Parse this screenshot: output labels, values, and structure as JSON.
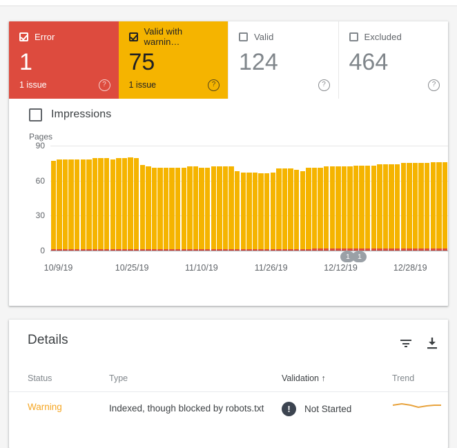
{
  "summary": {
    "cards": [
      {
        "label": "Error",
        "value": "1",
        "sub": "1 issue",
        "help": "?",
        "state": "error",
        "checked": true
      },
      {
        "label": "Valid with warnin…",
        "value": "75",
        "sub": "1 issue",
        "help": "?",
        "state": "warning",
        "checked": true
      },
      {
        "label": "Valid",
        "value": "124",
        "sub": "",
        "help": "?",
        "state": "valid",
        "checked": false
      },
      {
        "label": "Excluded",
        "value": "464",
        "sub": "",
        "help": "?",
        "state": "excluded",
        "checked": false
      }
    ]
  },
  "impressions": {
    "label": "Impressions",
    "checked": false
  },
  "chart_data": {
    "type": "bar",
    "title": "",
    "xlabel": "",
    "ylabel": "Pages",
    "ylim": [
      0,
      90
    ],
    "yticks": [
      "0",
      "30",
      "60",
      "90"
    ],
    "grid": true,
    "legend": "none",
    "categories": [
      "10/9/19",
      "10/25/19",
      "11/10/19",
      "11/26/19",
      "12/12/19",
      "12/28/19"
    ],
    "tick_positions_pct": [
      2,
      20.5,
      38,
      55.5,
      73,
      90.5
    ],
    "series": [
      {
        "name": "Valid with warnings",
        "color": "#f5b400",
        "values": [
          77,
          78,
          78,
          78,
          78,
          78,
          78,
          79,
          79,
          79,
          78,
          79,
          79,
          80,
          79,
          73,
          72,
          71,
          71,
          71,
          71,
          71,
          71,
          72,
          72,
          71,
          71,
          72,
          72,
          72,
          72,
          68,
          67,
          67,
          67,
          66,
          66,
          67,
          70,
          70,
          70,
          69,
          68,
          71,
          71,
          71,
          72,
          72,
          72,
          72,
          72,
          73,
          73,
          73,
          73,
          74,
          74,
          74,
          74,
          75,
          75,
          75,
          75,
          75,
          76,
          76,
          76
        ]
      },
      {
        "name": "Error",
        "color": "#dd4b3e",
        "values": [
          1,
          1,
          1,
          1,
          1,
          1,
          1,
          1,
          1,
          1,
          1,
          1,
          1,
          1,
          1,
          1,
          1,
          1,
          1,
          1,
          1,
          1,
          1,
          1,
          1,
          1,
          1,
          1,
          1,
          1,
          1,
          1,
          1,
          1,
          1,
          1,
          1,
          1,
          1,
          1,
          1,
          1,
          1,
          1,
          2,
          2,
          2,
          2,
          2,
          2,
          2,
          2,
          2,
          2,
          2,
          2,
          2,
          2,
          2,
          2,
          2,
          2,
          2,
          2,
          2,
          2,
          2
        ]
      }
    ],
    "annotations": [
      {
        "label": "1",
        "x_pct": 73
      },
      {
        "label": "1",
        "x_pct": 75.5
      }
    ]
  },
  "details": {
    "title": "Details",
    "filter_icon": "filter-icon",
    "download_icon": "download-icon",
    "columns": [
      {
        "key": "status",
        "label": "Status",
        "sorted": false
      },
      {
        "key": "type",
        "label": "Type",
        "sorted": false
      },
      {
        "key": "validation",
        "label": "Validation",
        "sorted": true,
        "sort_arrow": "↑"
      },
      {
        "key": "trend",
        "label": "Trend",
        "sorted": false
      }
    ],
    "rows": [
      {
        "status": "Warning",
        "type": "Indexed, though blocked by robots.txt",
        "validation": "Not Started",
        "validation_icon": "exclamation-icon",
        "validation_icon_glyph": "!",
        "trend": "flat-sparkline"
      }
    ]
  },
  "colors": {
    "error": "#dd4b3e",
    "warning": "#f5b400",
    "valid": "#80868b",
    "excluded": "#80868b",
    "accent_text": "#f5a623",
    "page_bg": "#f5f5f5"
  }
}
